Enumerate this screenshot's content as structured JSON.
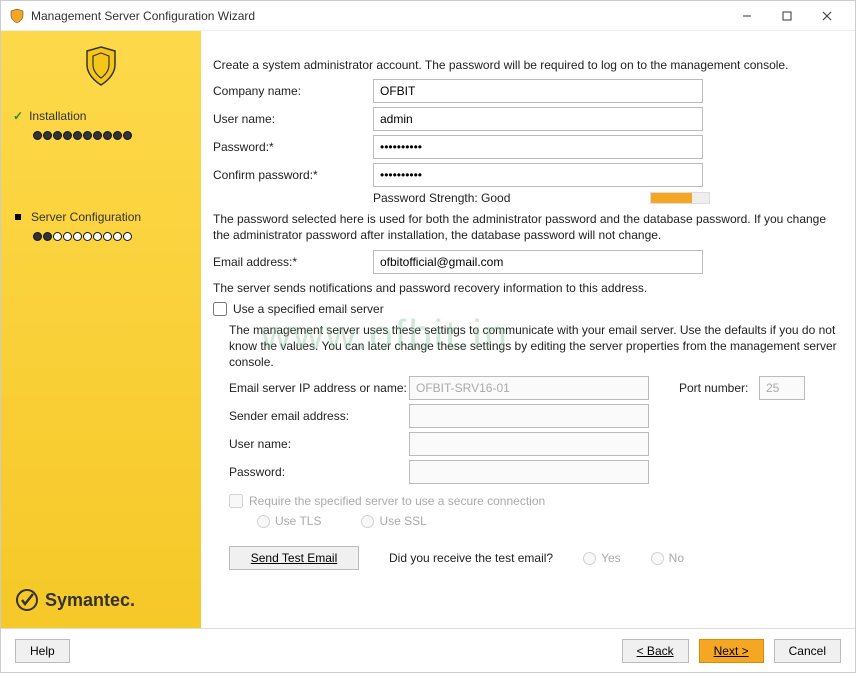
{
  "window": {
    "title": "Management Server Configuration Wizard"
  },
  "sidebar": {
    "items": [
      {
        "label": "Installation"
      },
      {
        "label": "Server Configuration"
      }
    ],
    "brand": "Symantec."
  },
  "content": {
    "intro": "Create a system administrator account. The password will be required to log on to the management console.",
    "company_lbl": "Company name:",
    "company_val": "OFBIT",
    "user_lbl": "User name:",
    "user_val": "admin",
    "pass_lbl": "Password:*",
    "pass_val": "••••••••••",
    "confirm_lbl": "Confirm password:*",
    "confirm_val": "••••••••••",
    "strength_lbl": "Password Strength: Good",
    "pass_note": "The password selected here is used for both the administrator password and the database password. If you change the administrator password after installation, the database password will not change.",
    "email_lbl": "Email address:*",
    "email_val": "ofbitofficial@gmail.com",
    "email_note": "The server sends notifications and password recovery information to this address.",
    "specified_cb": "Use a specified email server",
    "specified_note": "The management server uses these settings to communicate with your email server.  Use the defaults if you do not know the values. You can later change these settings by editing the server properties from the management server console.",
    "srv_lbl": "Email server IP address or name:",
    "srv_val": "OFBIT-SRV16-01",
    "port_lbl": "Port number:",
    "port_val": "25",
    "sender_lbl": "Sender email address:",
    "user2_lbl": "User name:",
    "pass2_lbl": "Password:",
    "secure_cb": "Require the specified server to use a secure connection",
    "tls": "Use TLS",
    "ssl": "Use SSL",
    "send_test": "Send Test Email",
    "did_receive": "Did you receive the test email?",
    "yes": "Yes",
    "no": "No"
  },
  "footer": {
    "help": "Help",
    "back": "< Back",
    "next": "Next >",
    "cancel": "Cancel"
  },
  "watermark": "www.ofbit.in"
}
